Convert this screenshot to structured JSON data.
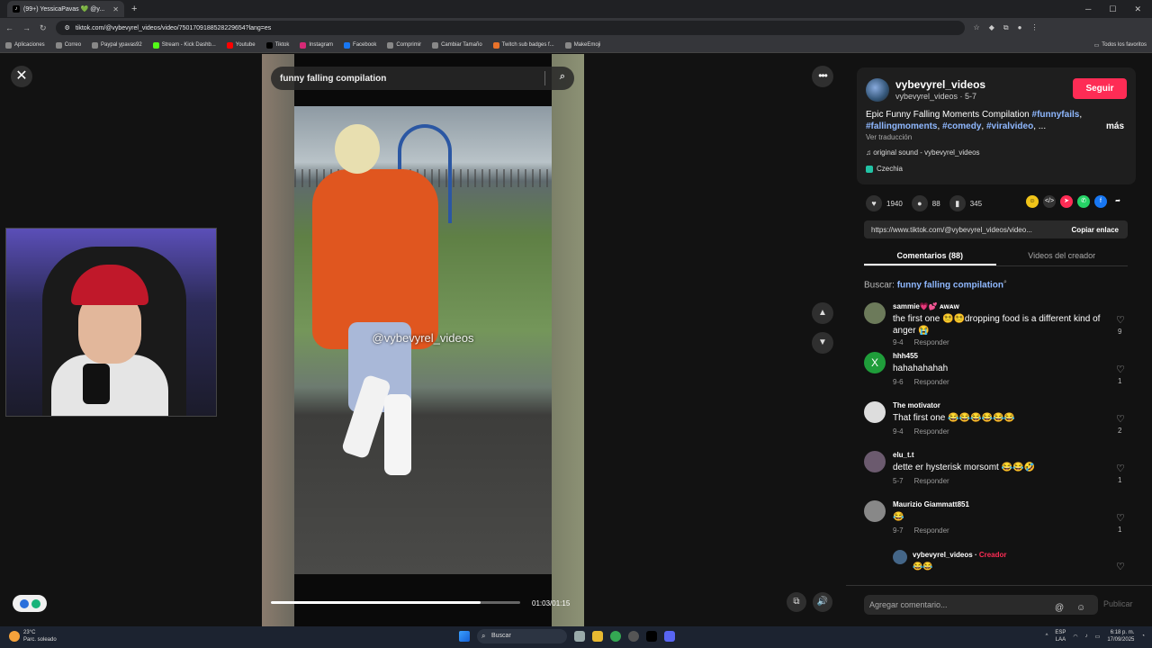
{
  "browser": {
    "tab_title": "(99+) YessicaPavas 💚 @y...",
    "url": "tiktok.com/@vybevyrel_videos/video/7501709188528229654?lang=es",
    "bookmarks": [
      "Aplicaciones",
      "Correo",
      "Paypal ypavas92",
      "Stream - Kick Dashb...",
      "Youtube",
      "Tiktok",
      "Instagram",
      "Facebook",
      "Comprimir",
      "Cambiar Tamaño",
      "Twitch sub badges f...",
      "MakeEmoji"
    ],
    "all_favorites": "Todos los favoritos"
  },
  "video": {
    "search_text": "funny falling compilation",
    "watermark": "@vybevyrel_videos",
    "timecode": "01:03/01:15",
    "progress": 0.84
  },
  "post": {
    "username": "vybevyrel_videos",
    "subline": "vybevyrel_videos · 5-7",
    "follow": "Seguir",
    "description": "Epic Funny Falling Moments Compilation",
    "hashtags": [
      "#funnyfails",
      "#fallingmoments",
      "#comedy",
      "#viralvideo"
    ],
    "ellipsis": ", ...",
    "more": "más",
    "translate": "Ver traducción",
    "sound": "original sound - vybevyrel_videos",
    "location": "Czechia",
    "likes": "1940",
    "comments": "88",
    "saves": "345",
    "link": "https://www.tiktok.com/@vybevyrel_videos/video...",
    "copy_link": "Copiar enlace",
    "tab_comments": "Comentarios (88)",
    "tab_creator": "Videos del creador",
    "search_label": "Buscar:",
    "search_query": "funny falling compilation"
  },
  "comments": [
    {
      "user": "sammie💗💕 ᴀᴡᴀᴡ",
      "text": "the first one 😵‍💫😵‍💫dropping food is a different kind of anger 😭",
      "date": "9-4",
      "likes": "9",
      "avatar": ""
    },
    {
      "user": "hhh455",
      "text": "hahahahahah",
      "date": "9-6",
      "likes": "1",
      "avatar": "X"
    },
    {
      "user": "The motivator",
      "text": "That first one 😂😂😂😂😂😂",
      "date": "9-4",
      "likes": "2",
      "avatar": ""
    },
    {
      "user": "elu_t.t",
      "text": "dette er hysterisk morsomt 😂😂🤣",
      "date": "5-7",
      "likes": "1",
      "avatar": ""
    },
    {
      "user": "Maurizio Giammatt851",
      "text": "😂",
      "date": "9-7",
      "likes": "1",
      "avatar": ""
    }
  ],
  "reply": {
    "user": "vybevyrel_videos",
    "creator": "Creador",
    "text": "😂😂"
  },
  "reply_label": "Responder",
  "comment_input": {
    "placeholder": "Agregar comentario...",
    "publish": "Publicar"
  },
  "taskbar": {
    "temp": "23°C",
    "weather": "Parc. soleado",
    "search": "Buscar",
    "lang": "ESP",
    "lang2": "LAA",
    "time": "6:18 p. m.",
    "date": "17/09/2025"
  }
}
